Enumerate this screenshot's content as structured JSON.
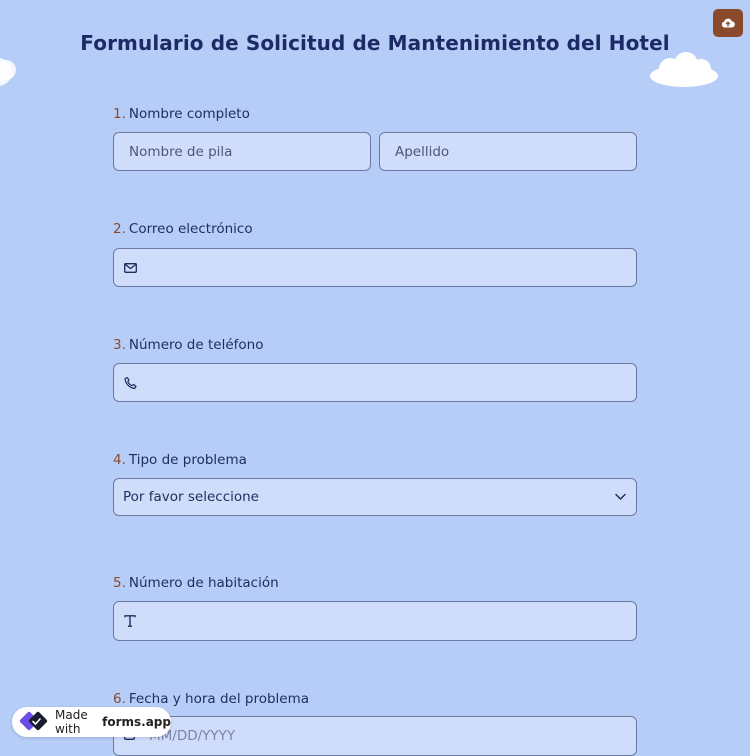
{
  "form": {
    "title": "Formulario de Solicitud de Mantenimiento del Hotel"
  },
  "questions": [
    {
      "number": "1.",
      "label": "Nombre completo",
      "fields": [
        {
          "placeholder": "Nombre de pila"
        },
        {
          "placeholder": "Apellido"
        }
      ]
    },
    {
      "number": "2.",
      "label": "Correo electrónico",
      "icon": "envelope-icon"
    },
    {
      "number": "3.",
      "label": "Número de teléfono",
      "icon": "phone-icon"
    },
    {
      "number": "4.",
      "label": "Tipo de problema",
      "selected": "Por favor seleccione",
      "icon": "chevron-down-icon"
    },
    {
      "number": "5.",
      "label": "Número de habitación",
      "icon": "text-t-icon"
    },
    {
      "number": "6.",
      "label": "Fecha y hora del problema",
      "placeholder": "MM/DD/YYYY",
      "icon": "calendar-icon"
    }
  ],
  "badge": {
    "prefix": "Made with",
    "brand": "forms.app"
  },
  "upload_button": {
    "icon": "cloud-upload-icon"
  },
  "colors": {
    "background": "#b6cdf7",
    "field_bg": "#cfddfb",
    "accent": "#8a4b2d",
    "title": "#1e2a66"
  }
}
